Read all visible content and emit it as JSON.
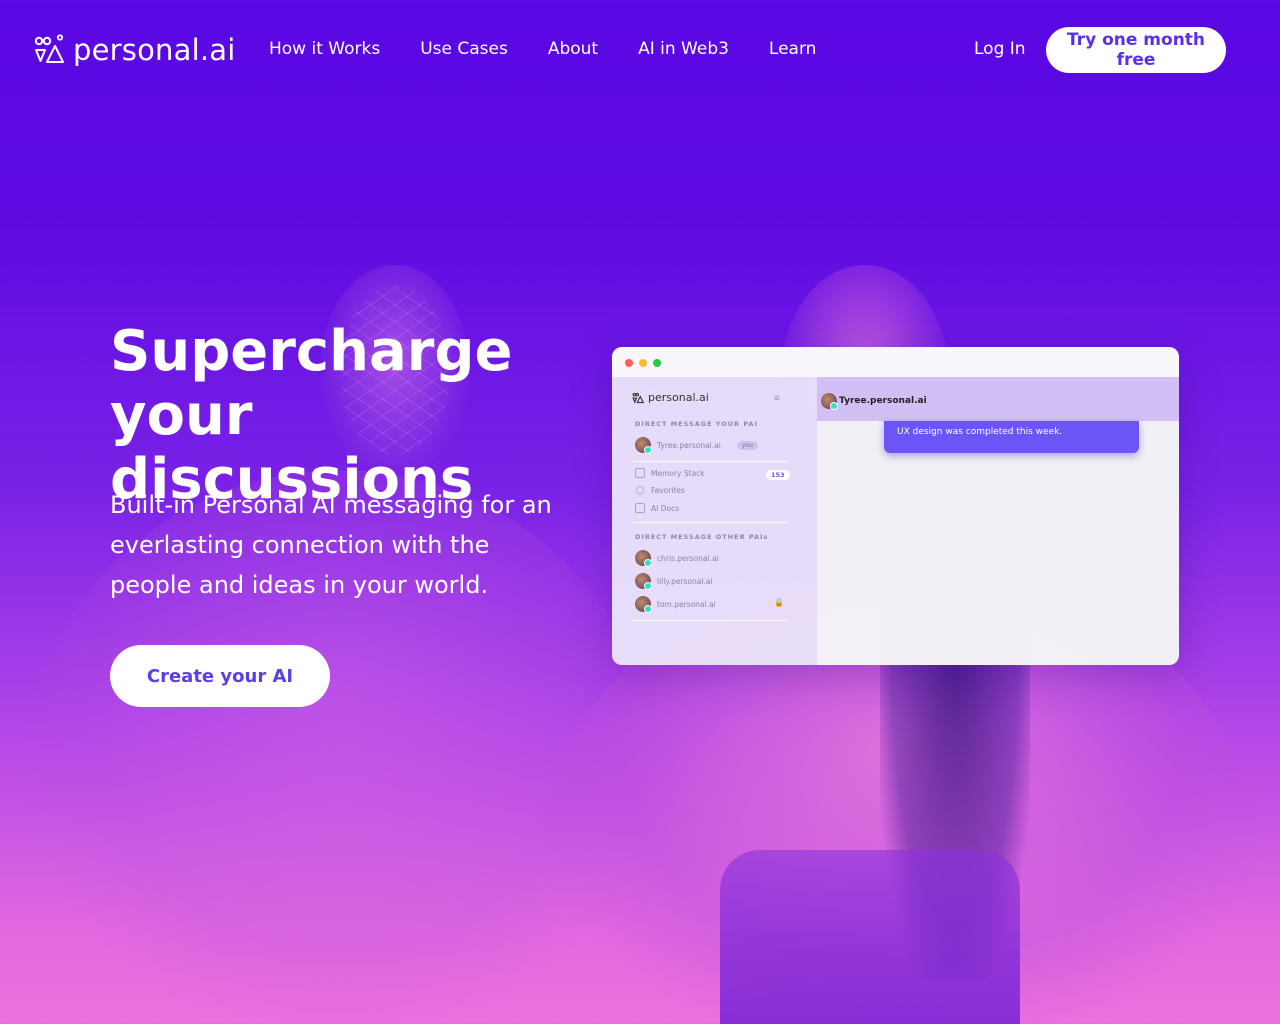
{
  "brand": {
    "name": "personal.ai"
  },
  "nav": {
    "items": [
      {
        "label": "How it Works"
      },
      {
        "label": "Use Cases"
      },
      {
        "label": "About"
      },
      {
        "label": "AI in Web3"
      },
      {
        "label": "Learn"
      }
    ],
    "login": "Log In",
    "cta": "Try one month free"
  },
  "hero": {
    "title_line1": "Supercharge",
    "title_line2": "your discussions",
    "subtitle": "Built-in Personal AI messaging for an everlasting connection with the people and ideas in your world.",
    "cta": "Create your AI"
  },
  "mockup": {
    "brand": "personal.ai",
    "section_direct": "DIRECT MESSAGE YOUR PAI",
    "self_user": "Tyree.personal.ai",
    "self_pill": "you",
    "memory_stack": "Memory Stack",
    "memory_count": "153",
    "favorites": "Favorites",
    "ai_docs": "AI Docs",
    "section_others": "DIRECT MESSAGE OTHER PAIs",
    "others": [
      {
        "name": "chris.personal.ai"
      },
      {
        "name": "lilly.personal.ai"
      },
      {
        "name": "tom.personal.ai"
      }
    ],
    "chat_user": "Tyree.personal.ai",
    "message": "UX design was completed this week."
  },
  "colors": {
    "bg_top": "#5a08e4",
    "bg_bottom": "#ec72de",
    "accent": "#5b2fe8",
    "bubble": "#6c55f5"
  }
}
